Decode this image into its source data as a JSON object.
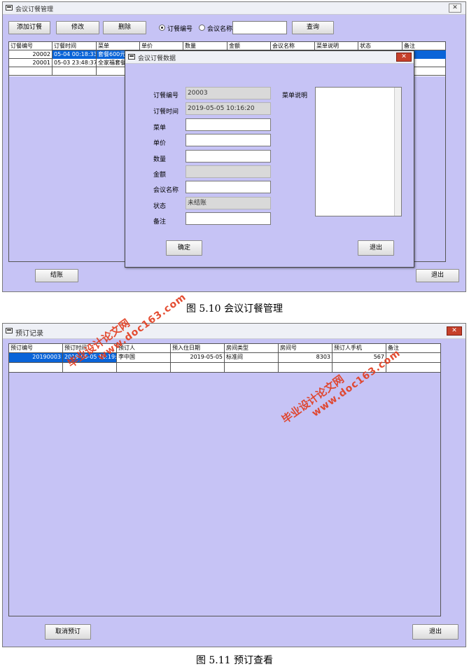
{
  "win1": {
    "title": "会议订餐管理",
    "toolbar": {
      "add": "添加订餐",
      "edit": "修改",
      "delete": "删除",
      "radio1": "订餐编号",
      "radio2": "会议名称",
      "search_value": "",
      "query": "查询"
    },
    "grid": {
      "headers": [
        "订餐编号",
        "订餐时间",
        "菜单",
        "单价",
        "数量",
        "金额",
        "会议名称",
        "菜单说明",
        "状态",
        "备注"
      ],
      "rows": [
        [
          "20002",
          "05-04 00:18:33",
          "套餐600元",
          "",
          "",
          "",
          "",
          "",
          "",
          ""
        ],
        [
          "20001",
          "05-03 23:48:37",
          "全家福套餐",
          "",
          "",
          "",
          "",
          "",
          "",
          ""
        ]
      ]
    },
    "checkout": "结账",
    "exit": "退出"
  },
  "dialog": {
    "title": "会议订餐数据",
    "fields": {
      "order_no_label": "订餐编号",
      "order_no": "20003",
      "time_label": "订餐时间",
      "time": "2019-05-05 10:16:20",
      "menu_label": "菜单",
      "menu": "",
      "price_label": "单价",
      "price": "",
      "qty_label": "数量",
      "qty": "",
      "amount_label": "金额",
      "amount": "",
      "meeting_label": "会议名称",
      "meeting": "",
      "status_label": "状态",
      "status": "未结账",
      "remark_label": "备注",
      "remark": "",
      "menu_desc_label": "菜单说明",
      "menu_desc": ""
    },
    "ok": "确定",
    "exit": "退出"
  },
  "caption1": "图 5.10 会议订餐管理",
  "win2": {
    "title": "预订记录",
    "grid": {
      "headers": [
        "预订编号",
        "预订时间",
        "预订人",
        "预入住日期",
        "房间类型",
        "房间号",
        "预订人手机",
        "备注"
      ],
      "rows": [
        [
          "20190003",
          "2019-05-05 10:19:11",
          "李中国",
          "2019-05-05",
          "标准间",
          "8303",
          "567",
          ""
        ]
      ]
    },
    "cancel": "取消预订",
    "exit": "退出"
  },
  "caption2": "图 5.11 预订查看",
  "watermarks": {
    "w1": {
      "line1": "毕业设计论文网",
      "line2": "www.doc163.com"
    },
    "w2": {
      "line1": "毕业设计论文网",
      "line2": "www.doc163.com"
    }
  },
  "colors": {
    "window_bg": "#c6c3f5",
    "selected": "#0a64d8",
    "watermark": "#e23a1c"
  }
}
